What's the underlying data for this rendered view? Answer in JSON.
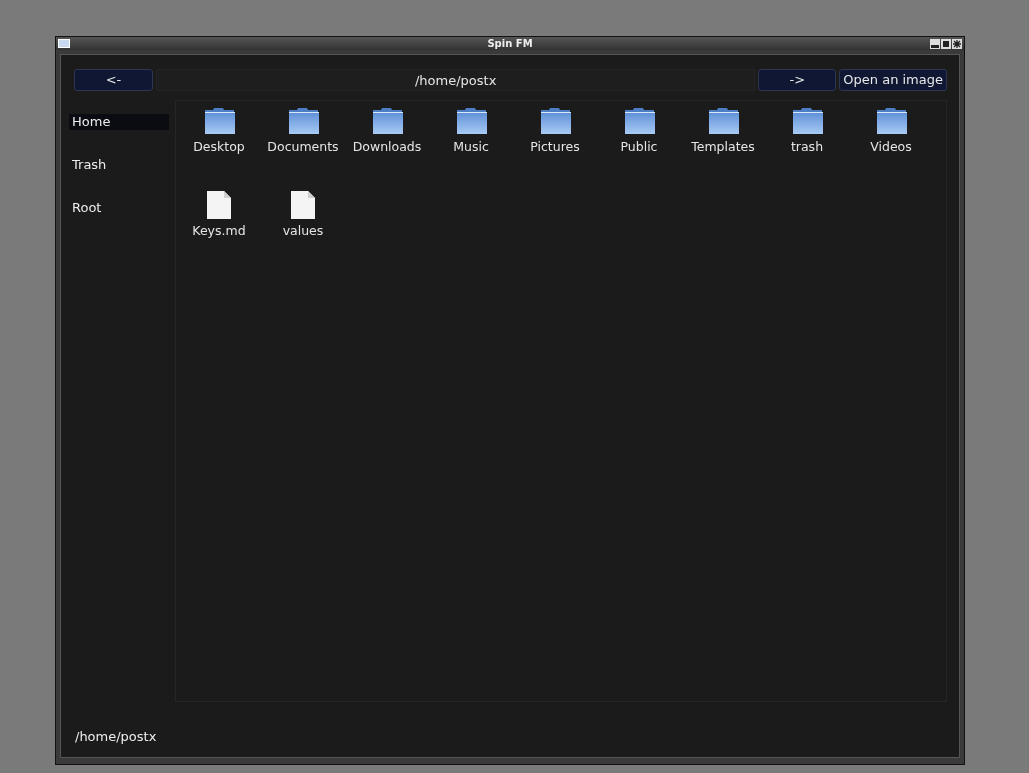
{
  "window": {
    "title": "Spin FM"
  },
  "toolbar": {
    "back": "<-",
    "path": "/home/postx",
    "forward": "->",
    "open_image": "Open an image"
  },
  "sidebar": {
    "items": [
      {
        "label": "Home",
        "selected": true
      },
      {
        "label": "Trash",
        "selected": false
      },
      {
        "label": "Root",
        "selected": false
      }
    ]
  },
  "files": [
    {
      "name": "Desktop",
      "kind": "folder"
    },
    {
      "name": "Documents",
      "kind": "folder"
    },
    {
      "name": "Downloads",
      "kind": "folder"
    },
    {
      "name": "Music",
      "kind": "folder"
    },
    {
      "name": "Pictures",
      "kind": "folder"
    },
    {
      "name": "Public",
      "kind": "folder"
    },
    {
      "name": "Templates",
      "kind": "folder"
    },
    {
      "name": "trash",
      "kind": "folder"
    },
    {
      "name": "Videos",
      "kind": "folder"
    },
    {
      "name": "Keys.md",
      "kind": "file"
    },
    {
      "name": "values",
      "kind": "file"
    }
  ],
  "status_bar": "/home/postx"
}
